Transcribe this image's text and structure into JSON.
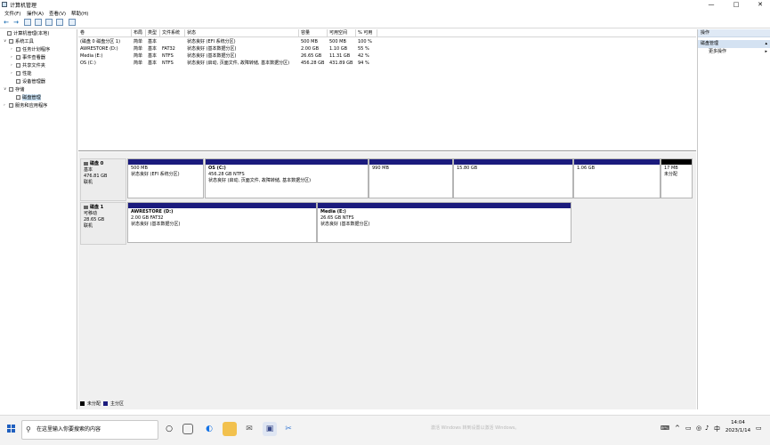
{
  "window": {
    "title": "计算机管理",
    "minimize": "—",
    "maximize": "□",
    "close": "✕"
  },
  "menu": [
    "文件(F)",
    "操作(A)",
    "查看(V)",
    "帮助(H)"
  ],
  "tree": {
    "root": "计算机管理(本地)",
    "system_tools": "系统工具",
    "task_scheduler": "任务计划程序",
    "event_viewer": "事件查看器",
    "shared_folders": "共享文件夹",
    "performance": "性能",
    "device_manager": "设备管理器",
    "storage": "存储",
    "disk_management": "磁盘管理",
    "services_apps": "服务和应用程序"
  },
  "volume_list": {
    "headers": [
      "卷",
      "布局",
      "类型",
      "文件系统",
      "状态",
      "容量",
      "可用空间",
      "% 可用"
    ],
    "rows": [
      [
        "(磁盘 0 磁盘分区 1)",
        "简单",
        "基本",
        "",
        "状态良好 (EFI 系统分区)",
        "500 MB",
        "500 MB",
        "100 %"
      ],
      [
        "AWRESTORE (D:)",
        "简单",
        "基本",
        "FAT32",
        "状态良好 (基本数据分区)",
        "2.00 GB",
        "1.10 GB",
        "55 %"
      ],
      [
        "Media (E:)",
        "简单",
        "基本",
        "NTFS",
        "状态良好 (基本数据分区)",
        "26.65 GB",
        "11.31 GB",
        "42 %"
      ],
      [
        "OS (C:)",
        "简单",
        "基本",
        "NTFS",
        "状态良好 (启动, 页面文件, 故障转储, 基本数据分区)",
        "456.28 GB",
        "431.89 GB",
        "94 %"
      ]
    ]
  },
  "disks": [
    {
      "name": "磁盘 0",
      "type": "基本",
      "size": "476.81 GB",
      "status": "联机",
      "partitions": [
        {
          "name": "",
          "size": "500 MB",
          "status": "状态良好 (EFI 系统分区)"
        },
        {
          "name": "OS (C:)",
          "size": "456.28 GB NTFS",
          "status": "状态良好 (启动, 页面文件, 故障转储, 基本数据分区)"
        },
        {
          "name": "",
          "size": "990 MB",
          "status": ""
        },
        {
          "name": "",
          "size": "15.80 GB",
          "status": ""
        },
        {
          "name": "",
          "size": "1.06 GB",
          "status": ""
        },
        {
          "name": "",
          "size": "17 MB",
          "status": "未分配"
        }
      ]
    },
    {
      "name": "磁盘 1",
      "type": "可移动",
      "size": "28.65 GB",
      "status": "联机",
      "partitions": [
        {
          "name": "AWRESTORE (D:)",
          "size": "2.00 GB FAT32",
          "status": "状态良好 (基本数据分区)"
        },
        {
          "name": "Media (E:)",
          "size": "26.65 GB NTFS",
          "status": "状态良好 (基本数据分区)"
        }
      ]
    }
  ],
  "legend": {
    "unallocated": "未分配",
    "primary": "主分区"
  },
  "actions": {
    "header": "操作",
    "section": "磁盘管理",
    "more": "更多操作"
  },
  "taskbar": {
    "search_placeholder": "在这里输入你要搜索的内容",
    "ghost_text": "激活 Windows 转到设置以激活 Windows。",
    "ime": "中",
    "time": "14:04",
    "date": "2023/1/14"
  },
  "colors": {
    "primary_partition": "#1b1b7d",
    "unallocated": "#000000",
    "selection": "#cce4f7"
  }
}
